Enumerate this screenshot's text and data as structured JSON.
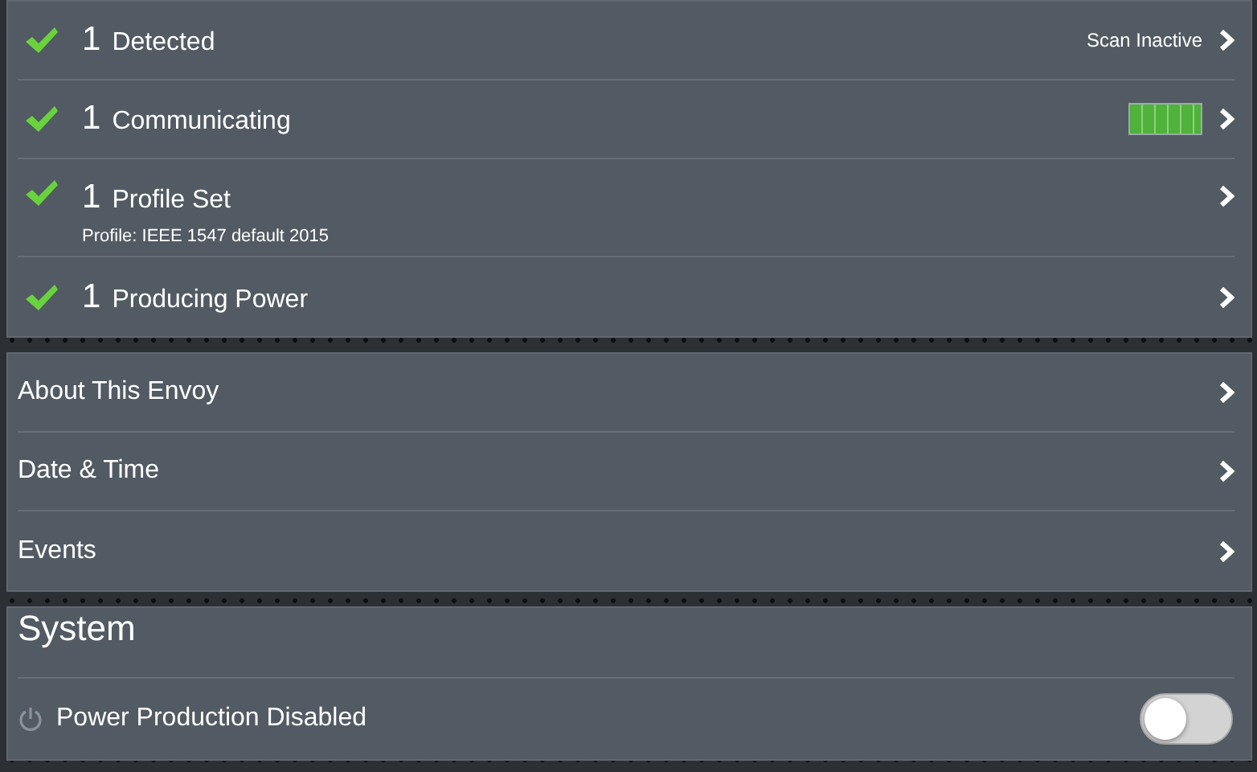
{
  "status_rows": [
    {
      "kind": "text",
      "checked": true,
      "count": "1",
      "label": "Detected",
      "value": "Scan Inactive"
    },
    {
      "kind": "signal",
      "checked": true,
      "count": "1",
      "label": "Communicating",
      "level": 1
    },
    {
      "kind": "detail",
      "checked": true,
      "count": "1",
      "label": "Profile Set",
      "detail": "Profile: IEEE 1547 default 2015"
    },
    {
      "kind": "plain",
      "checked": true,
      "count": "1",
      "label": "Producing Power"
    }
  ],
  "menu_items": [
    {
      "label": "About This Envoy"
    },
    {
      "label": "Date & Time"
    },
    {
      "label": "Events"
    }
  ],
  "system": {
    "title": "System",
    "power_production": {
      "label": "Power Production Disabled",
      "on": false
    }
  }
}
